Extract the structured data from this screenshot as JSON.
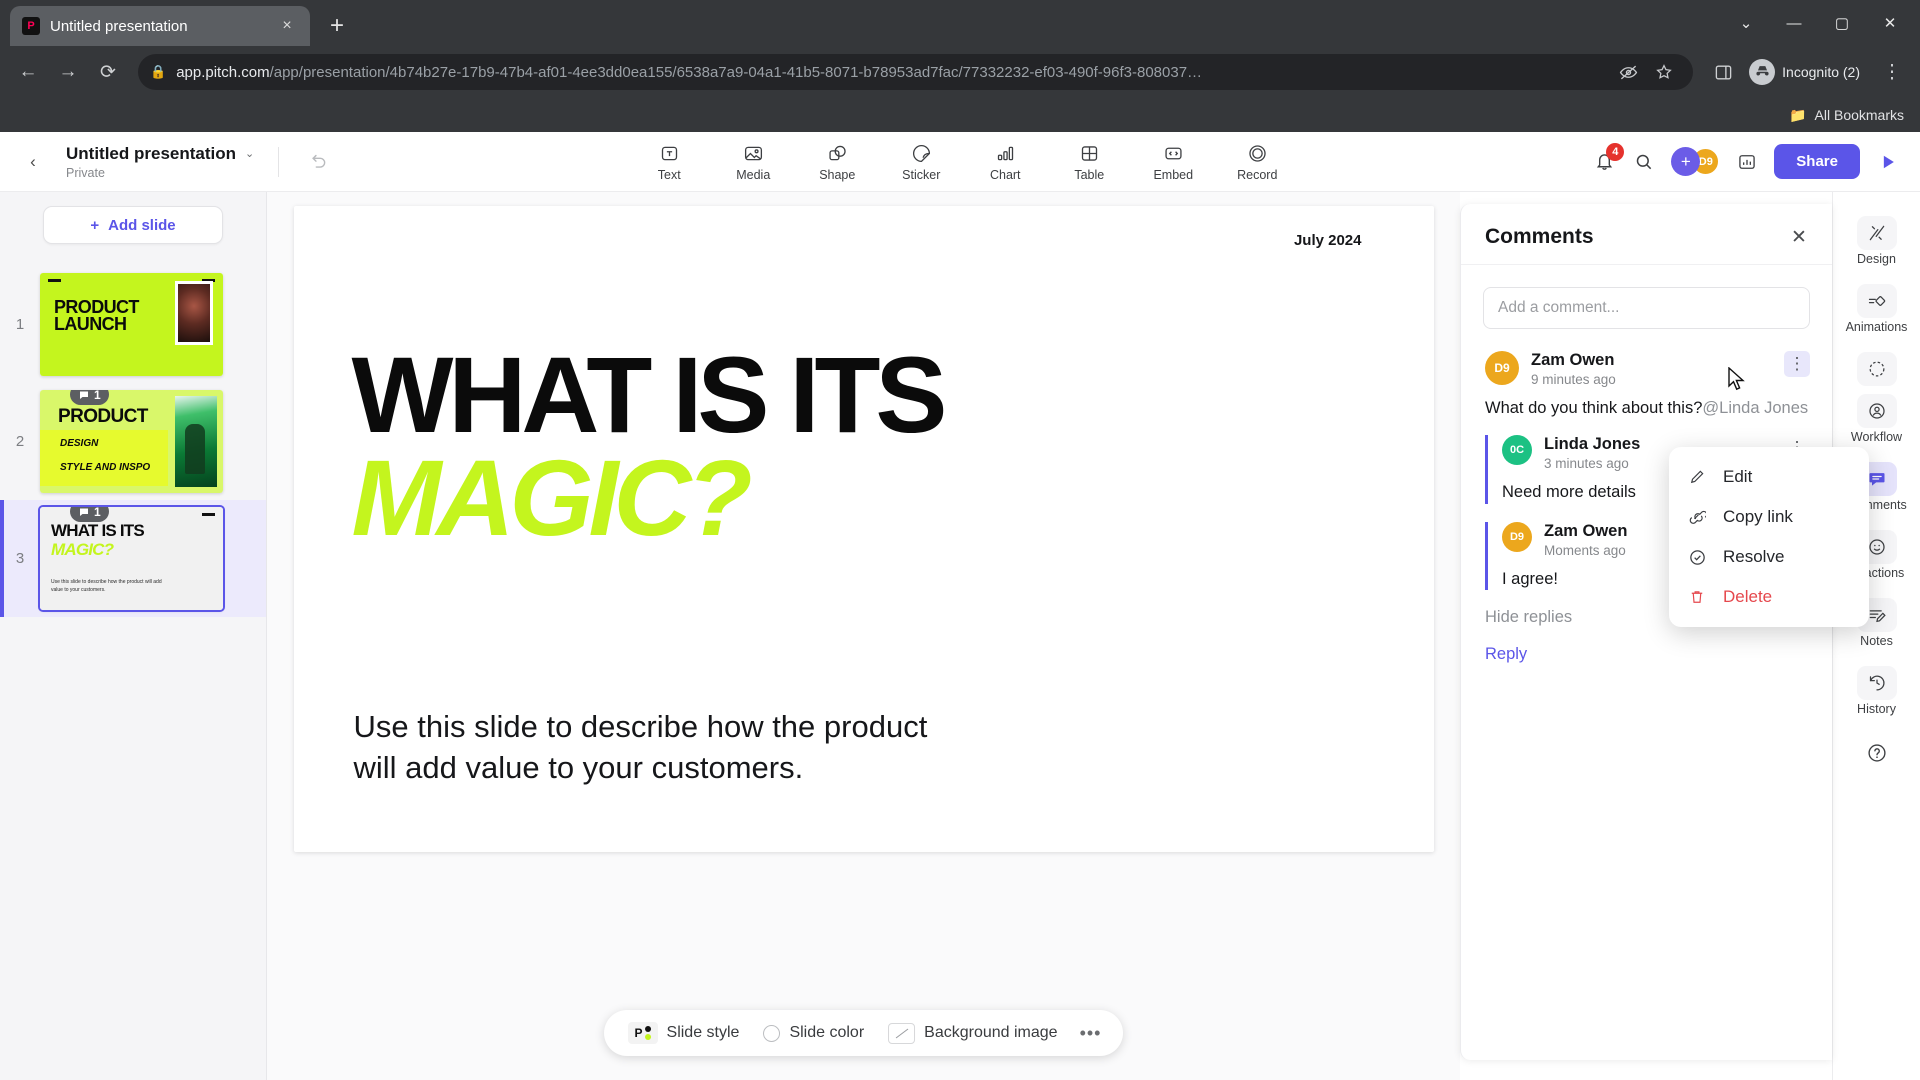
{
  "browser": {
    "tab": {
      "title": "Untitled presentation",
      "favicon": "pitch-logo-icon",
      "close": "×"
    },
    "new_tab": "+",
    "window_controls": {
      "minimize": "—",
      "maximize": "▢",
      "close": "✕",
      "more": "⌄"
    },
    "nav": {
      "back": "←",
      "forward": "→",
      "reload": "⟳"
    },
    "omnibox": {
      "lock": "site-info-icon",
      "url_host": "app.pitch.com",
      "url_path": "/app/presentation/4b74b27e-17b9-47b4-af01-4ee3dd0ea155/6538a7a9-04a1-41b5-8071-b78953ad7fac/77332232-ef03-490f-96f3-808037…",
      "eye_icon": "hidden-eye-icon",
      "star_icon": "bookmark-star-icon"
    },
    "sidepanel_icon": "side-panel-icon",
    "profile": {
      "label": "Incognito (2)",
      "avatar": "incognito-avatar"
    },
    "menu": "⋮",
    "bookmarks_bar": {
      "label": "All Bookmarks",
      "folder_icon": "folder-icon"
    }
  },
  "app_header": {
    "back": "‹",
    "title": "Untitled presentation",
    "caret": "⌄",
    "visibility": "Private",
    "undo": "undo-icon",
    "tools": [
      {
        "label": "Text",
        "icon": "text-box-icon"
      },
      {
        "label": "Media",
        "icon": "image-icon"
      },
      {
        "label": "Shape",
        "icon": "shape-icon"
      },
      {
        "label": "Sticker",
        "icon": "sticker-icon"
      },
      {
        "label": "Chart",
        "icon": "bar-chart-icon"
      },
      {
        "label": "Table",
        "icon": "table-grid-icon"
      },
      {
        "label": "Embed",
        "icon": "code-embed-icon"
      },
      {
        "label": "Record",
        "icon": "record-circle-icon"
      }
    ],
    "notifications": {
      "icon": "bell-icon",
      "count": "4"
    },
    "search_icon": "search-icon",
    "add_collaborator": "+",
    "collaborator_initials": "D9",
    "analytics_icon": "analytics-icon",
    "share_label": "Share",
    "present_icon": "play-icon"
  },
  "slides_pane": {
    "add_slide": {
      "label": "Add slide",
      "icon": "plus-icon"
    },
    "slides": [
      {
        "number": "1",
        "comment_count": null,
        "selected": false,
        "title_line1": "PRODUCT",
        "title_line2": "LAUNCH"
      },
      {
        "number": "2",
        "comment_count": "1",
        "selected": false,
        "title_line1": "PRODUCT",
        "sub1": "DESIGN",
        "sub2": "STYLE AND INSPO"
      },
      {
        "number": "3",
        "comment_count": "1",
        "selected": true,
        "title_line1": "WHAT IS ITS",
        "title_line2": "MAGIC?",
        "body": "Use this slide to describe how the product will add value to your customers."
      }
    ]
  },
  "slide": {
    "date": "July 2024",
    "heading_line1": "WHAT IS ITS",
    "heading_line2": "MAGIC?",
    "body": "Use this slide to describe how the product will add value to your customers."
  },
  "style_tray": {
    "slide_style": {
      "label": "Slide style",
      "badge": "P"
    },
    "slide_color": {
      "label": "Slide color"
    },
    "background_image": {
      "label": "Background image"
    },
    "more": "•••"
  },
  "comments_panel": {
    "title": "Comments",
    "close": "✕",
    "input_placeholder": "Add a comment...",
    "thread": {
      "author": "Zam Owen",
      "initials": "D9",
      "time": "9 minutes ago",
      "text": "What do you think about this?",
      "mention": "@Linda Jones",
      "kebab": "⋮",
      "replies": [
        {
          "author": "Linda Jones",
          "initials": "0C",
          "time": "3 minutes ago",
          "text": "Need more details",
          "kebab": "⋮"
        },
        {
          "author": "Zam Owen",
          "initials": "D9",
          "time": "Moments ago",
          "text": "I agree!",
          "kebab": "⋮"
        }
      ],
      "hide_replies": "Hide replies",
      "reply": "Reply"
    },
    "context_menu": [
      {
        "label": "Edit",
        "icon": "pencil-icon",
        "danger": false
      },
      {
        "label": "Copy link",
        "icon": "link-icon",
        "danger": false
      },
      {
        "label": "Resolve",
        "icon": "check-circle-icon",
        "danger": false
      },
      {
        "label": "Delete",
        "icon": "trash-icon",
        "danger": true
      }
    ]
  },
  "right_rail": {
    "items": [
      {
        "label": "Design",
        "icon": "design-brushes-icon",
        "active": false
      },
      {
        "label": "Animations",
        "icon": "animations-icon",
        "active": false
      },
      {
        "label": "Workflow",
        "icon": "workflow-icon",
        "secondary_icon": "assignee-icon",
        "active": false
      },
      {
        "label": "Comments",
        "icon": "comment-bubble-icon",
        "active": true
      },
      {
        "label": "Reactions",
        "icon": "smiley-icon",
        "active": false
      },
      {
        "label": "Notes",
        "icon": "notes-icon",
        "active": false
      },
      {
        "label": "History",
        "icon": "history-icon",
        "active": false
      }
    ],
    "help": "?"
  },
  "colors": {
    "accent": "#5b55e8",
    "neon": "#c4f51e",
    "badge_red": "#e5322d",
    "avatar_orange": "#eca71d",
    "avatar_green": "#1cc183",
    "danger": "#e5484d"
  }
}
